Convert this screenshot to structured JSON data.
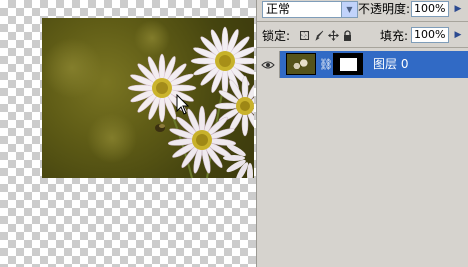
{
  "layers_panel": {
    "blend_mode": "正常",
    "opacity_label": "不透明度:",
    "opacity_value": "100%",
    "lock_label": "锁定:",
    "fill_label": "填充:",
    "fill_value": "100%",
    "layer": {
      "name": "图层 0"
    }
  },
  "icons": {
    "lock_transparent": "checkerboard-box",
    "lock_paint": "brush",
    "lock_move": "move-arrows",
    "lock_all": "padlock",
    "visibility": "eye",
    "link": "chain"
  },
  "colors": {
    "selection": "#316ac5",
    "panel": "#d6d3ce",
    "field_border": "#7f9db9"
  }
}
